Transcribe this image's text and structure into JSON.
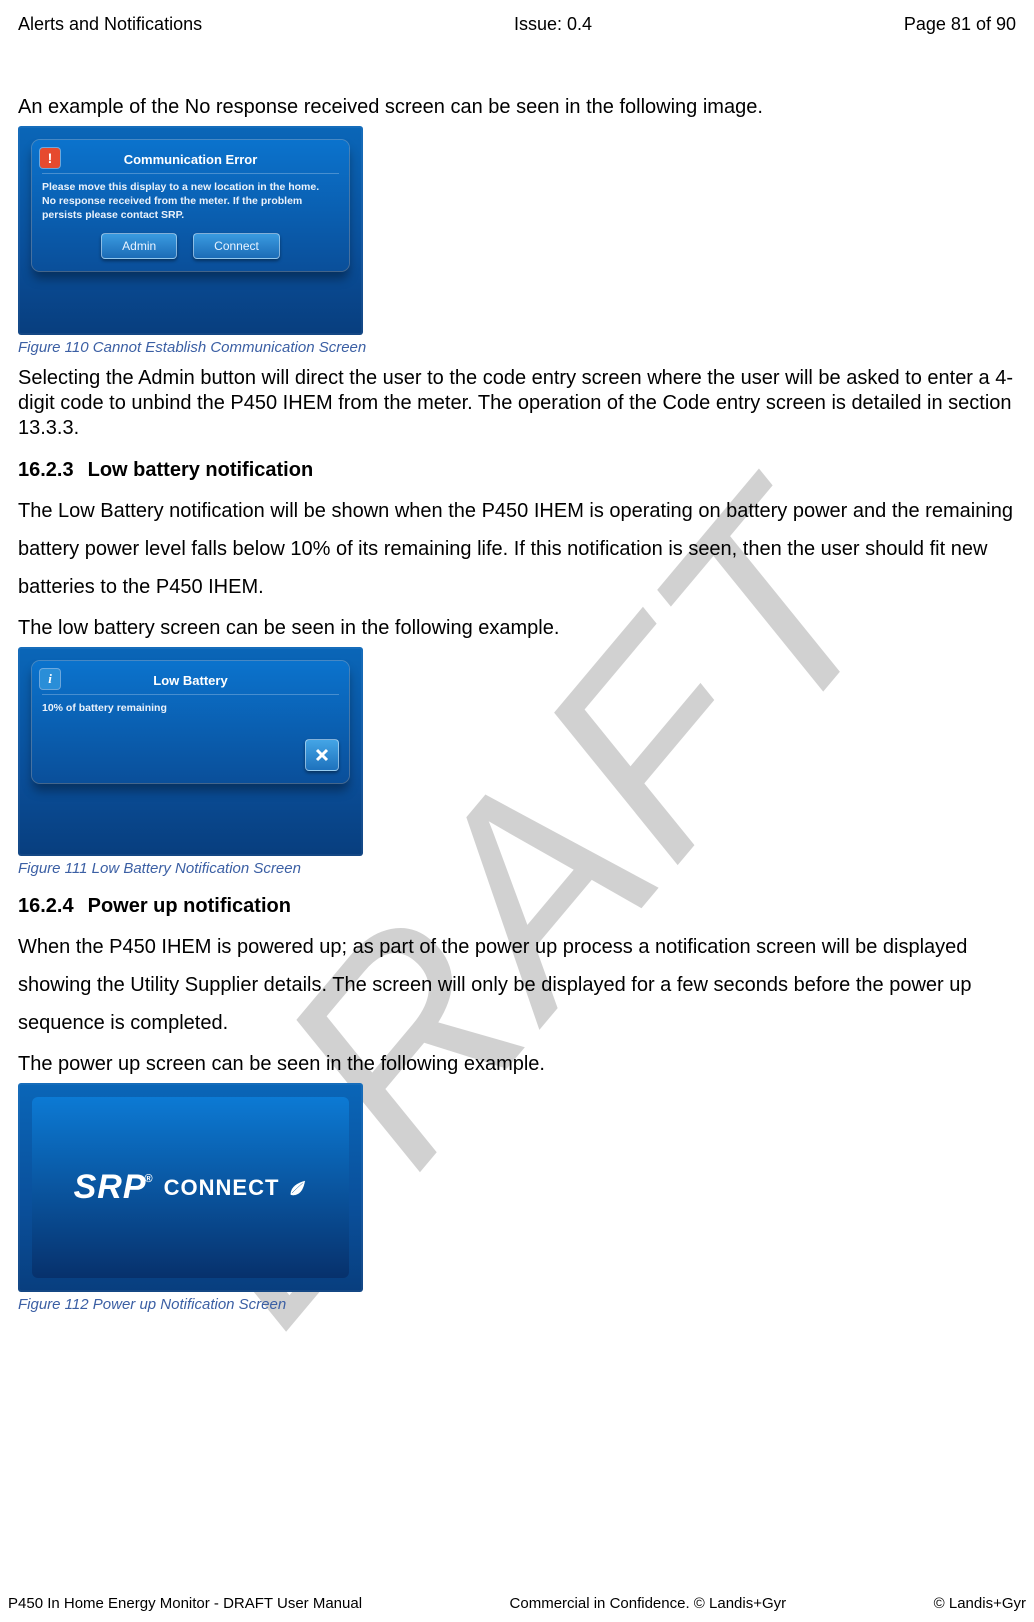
{
  "header": {
    "section": "Alerts and Notifications",
    "issue": "Issue: 0.4",
    "page": "Page 81 of 90"
  },
  "watermark": "DRAFT",
  "intro_line": "An example of the No response received screen can be seen in the following image.",
  "fig110": {
    "title": "Communication Error",
    "line1": "Please move this display to a new location in the home.",
    "line2": "No response received from the meter. If the problem persists please contact SRP.",
    "btn_admin": "Admin",
    "btn_connect": "Connect",
    "caption": "Figure 110 Cannot Establish Communication Screen"
  },
  "para_after_110": "Selecting the Admin button will direct the user to the code entry screen where the user will be asked to enter a 4-digit code to unbind the P450 IHEM from the meter. The operation of the Code entry screen is detailed in section 13.3.3.",
  "sec_1623": {
    "num": "16.2.3",
    "title": "Low battery notification",
    "p1": "The Low Battery notification will be shown when the P450 IHEM is operating on battery power and the remaining battery power level falls below 10% of its remaining life. If this notification is seen, then the user should fit new batteries to the P450 IHEM.",
    "p2": "The low battery screen can be seen in the following example."
  },
  "fig111": {
    "title": "Low Battery",
    "body": "10% of battery remaining",
    "caption": "Figure 111 Low Battery Notification Screen"
  },
  "sec_1624": {
    "num": "16.2.4",
    "title": "Power up notification",
    "p1": "When the P450 IHEM is powered up; as part of the power up process a notification screen will be displayed showing the Utility Supplier details. The screen will only be displayed for a few seconds before the power up sequence is completed.",
    "p2": "The power up screen can be seen in the following example."
  },
  "fig112": {
    "logo_brand": "SRP",
    "logo_word": "CONNECT",
    "caption": "Figure 112  Power up Notification Screen"
  },
  "footer": {
    "left": "P450 In Home Energy Monitor - DRAFT User Manual",
    "center": "Commercial in Confidence. © Landis+Gyr",
    "right": "© Landis+Gyr"
  }
}
